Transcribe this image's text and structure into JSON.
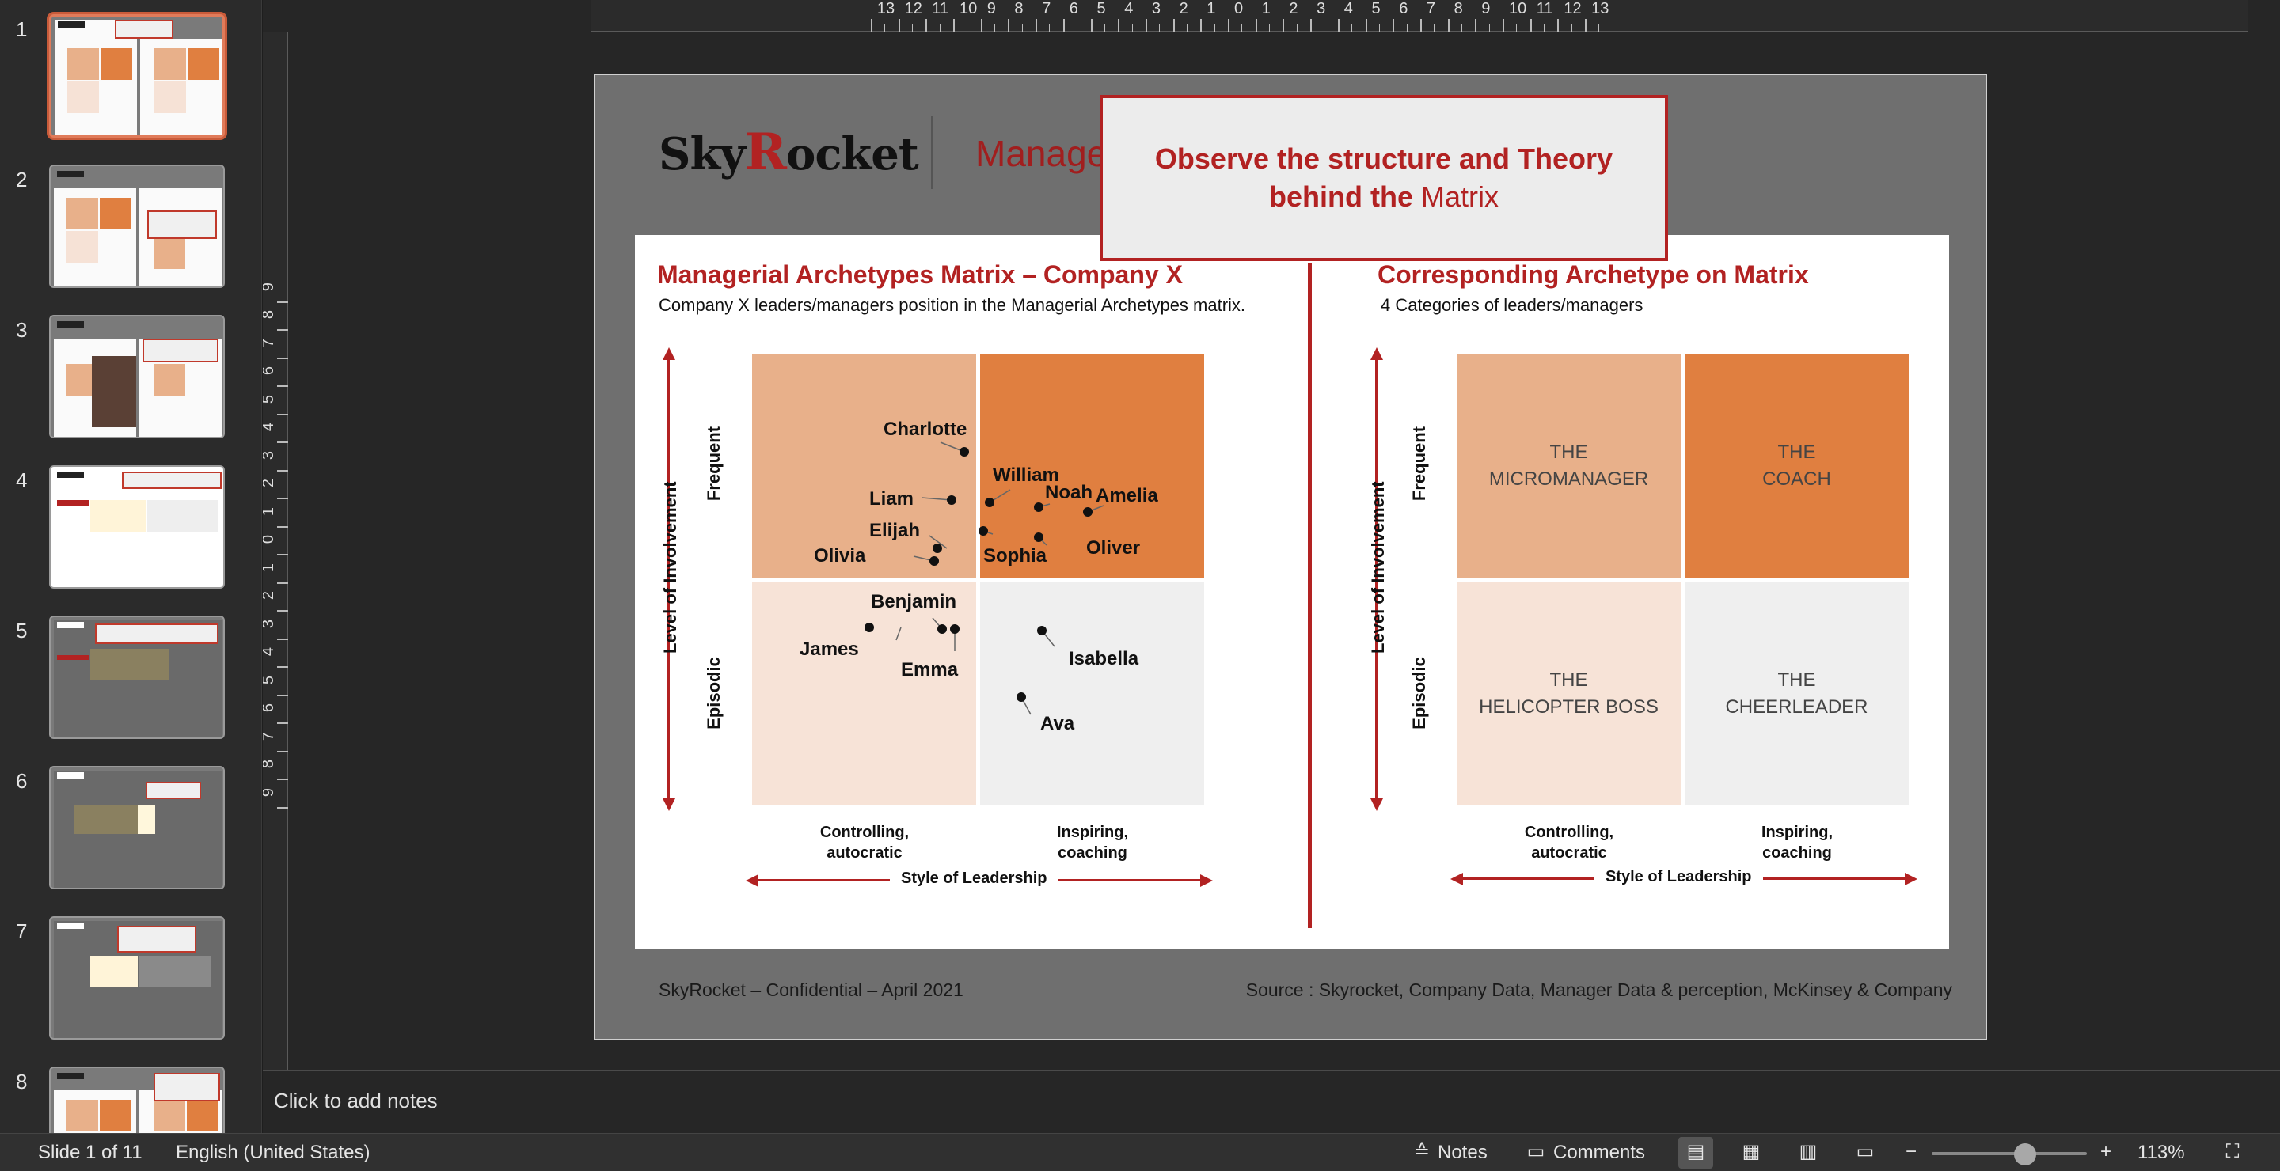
{
  "thumbnails": [
    {
      "num": "1"
    },
    {
      "num": "2"
    },
    {
      "num": "3"
    },
    {
      "num": "4"
    },
    {
      "num": "5"
    },
    {
      "num": "6"
    },
    {
      "num": "7"
    },
    {
      "num": "8"
    }
  ],
  "slide": {
    "logo": {
      "pre": "Sky",
      "r": "R",
      "post": "ocket"
    },
    "title": "Managerial Archetypes Matrix Template",
    "callout": {
      "bold": "Observe the structure and Theory",
      "line2_bold": "behind the",
      "line2_normal": "Matrix"
    },
    "left_panel": {
      "title": "Managerial Archetypes Matrix – Company X",
      "subtitle": "Company X leaders/managers position in the Managerial Archetypes matrix.",
      "y_axis": "Level of Involvement",
      "y_top": "Frequent",
      "y_bottom": "Episodic",
      "x_left": "Controlling,\nautocratic",
      "x_right": "Inspiring,\ncoaching",
      "x_axis": "Style of Leadership",
      "people": [
        {
          "name": "Charlotte"
        },
        {
          "name": "William"
        },
        {
          "name": "Liam"
        },
        {
          "name": "Noah"
        },
        {
          "name": "Amelia"
        },
        {
          "name": "Elijah"
        },
        {
          "name": "Olivia"
        },
        {
          "name": "Sophia"
        },
        {
          "name": "Oliver"
        },
        {
          "name": "Benjamin"
        },
        {
          "name": "James"
        },
        {
          "name": "Emma"
        },
        {
          "name": "Isabella"
        },
        {
          "name": "Ava"
        }
      ]
    },
    "right_panel": {
      "title": "Corresponding Archetype on Matrix",
      "subtitle": "4 Categories of leaders/managers",
      "y_axis": "Level of Involvement",
      "y_top": "Frequent",
      "y_bottom": "Episodic",
      "x_left": "Controlling,\nautocratic",
      "x_right": "Inspiring,\ncoaching",
      "x_axis": "Style of Leadership",
      "q_tl": "THE\nMICROMANAGER",
      "q_tr": "THE\nCOACH",
      "q_bl": "THE\nHELICOPTER BOSS",
      "q_br": "THE\nCHEERLEADER"
    },
    "footer_left": "SkyRocket – Confidential – April 2021",
    "footer_right": "Source : Skyrocket, Company Data, Manager Data & perception, McKinsey & Company"
  },
  "notes_placeholder": "Click to add notes",
  "status": {
    "slide_count": "Slide 1 of 11",
    "language": "English (United States)",
    "notes": "Notes",
    "comments": "Comments",
    "zoom": "113%",
    "zoom_fraction": 0.6
  },
  "colors": {
    "accent_red": "#b22222",
    "quad_frequent_controlling": "#e8b08a",
    "quad_frequent_inspiring": "#e07f40",
    "quad_episodic_controlling": "#f7e3d7",
    "quad_episodic_inspiring": "#efefef"
  }
}
